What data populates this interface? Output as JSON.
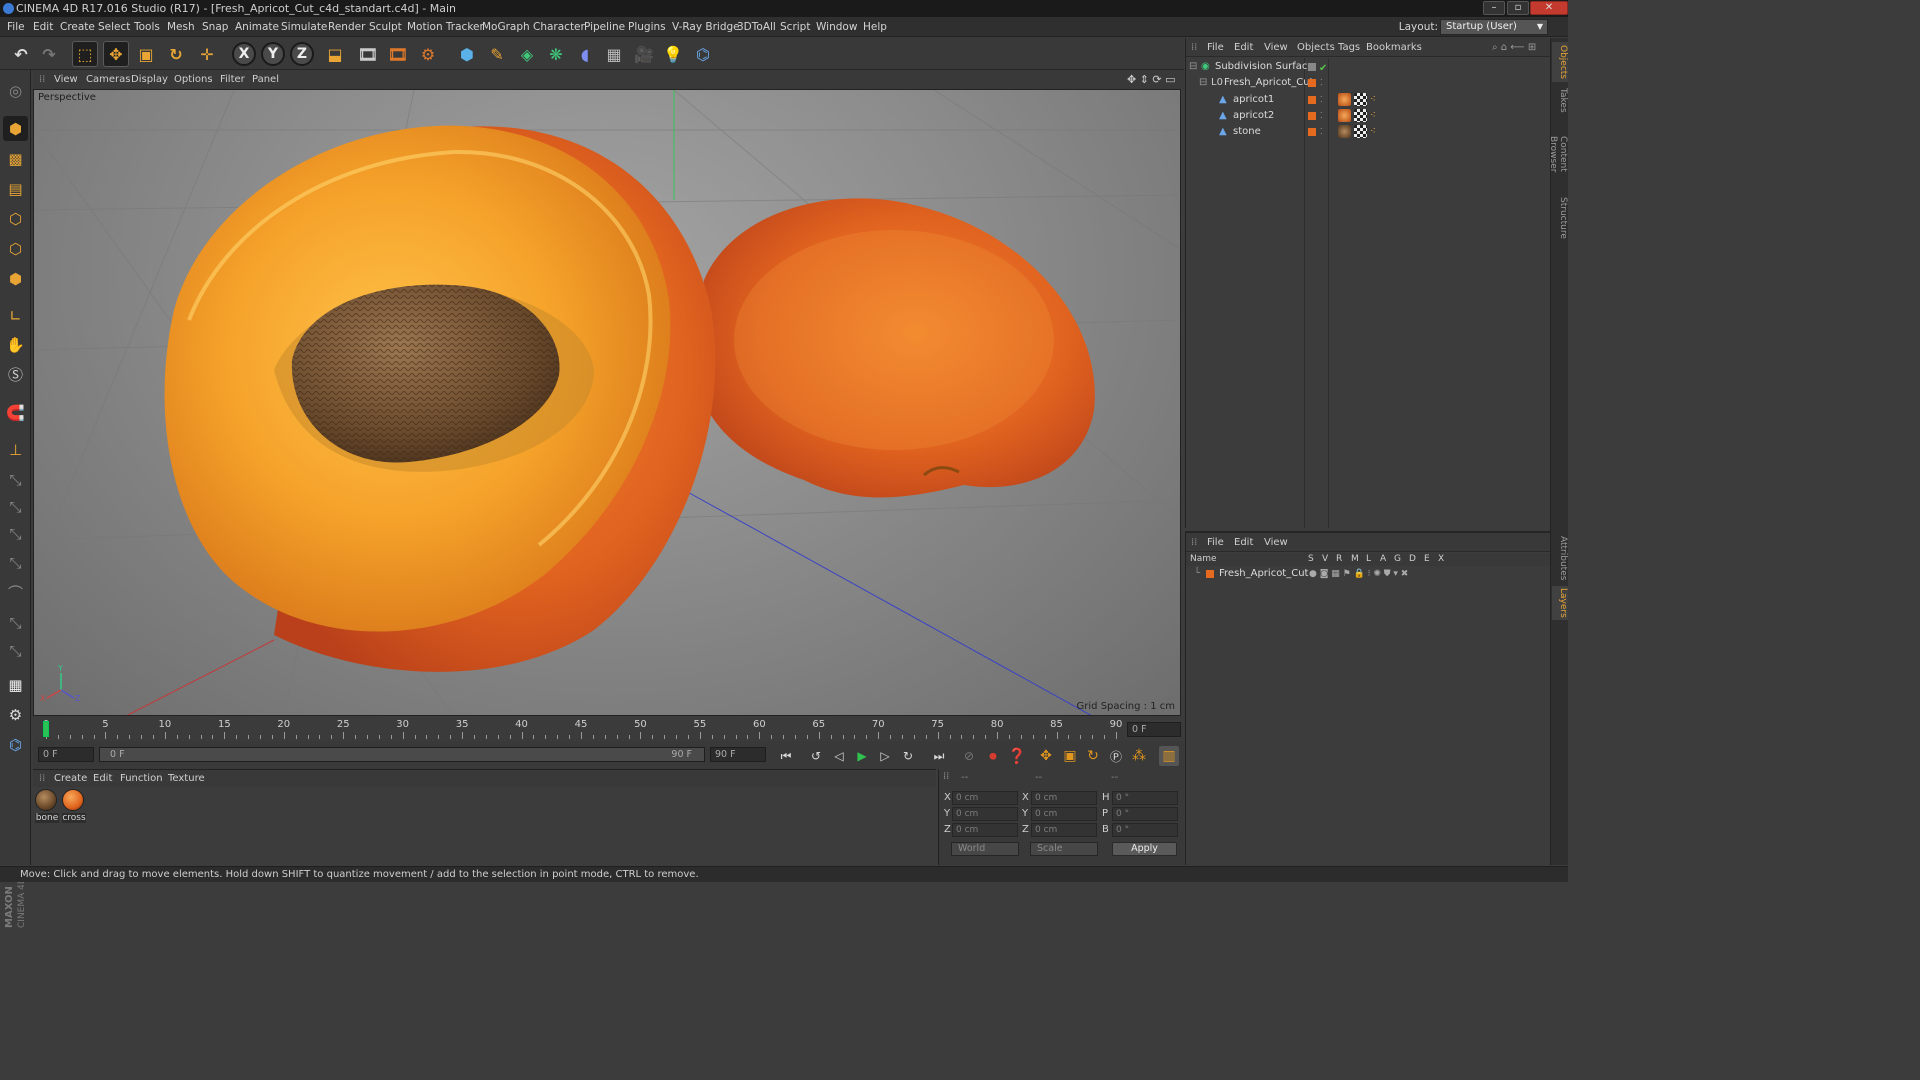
{
  "titlebar": {
    "title": "CINEMA 4D R17.016 Studio (R17) - [Fresh_Apricot_Cut_c4d_standart.c4d] - Main",
    "min": "–",
    "max": "▫",
    "close": "✕"
  },
  "menubar": {
    "items": [
      "File",
      "Edit",
      "Create",
      "Select",
      "Tools",
      "Mesh",
      "Snap",
      "Animate",
      "Simulate",
      "Render",
      "Sculpt",
      "Motion Tracker",
      "MoGraph",
      "Character",
      "Pipeline",
      "Plugins",
      "V-Ray Bridge",
      "3DToAll",
      "Script",
      "Window",
      "Help"
    ],
    "layout_label": "Layout:",
    "layout_value": "Startup (User)"
  },
  "toolbar": {
    "axis_x": "X",
    "axis_y": "Y",
    "axis_z": "Z",
    "icons": [
      "undo-icon",
      "redo-icon",
      "select-icon",
      "move-icon",
      "scale-icon",
      "rotate-icon",
      "axis-icon",
      "x-lock-icon",
      "y-lock-icon",
      "z-lock-icon",
      "coordinate-system-icon",
      "render-view-icon",
      "render-picture-viewer-icon",
      "render-settings-icon",
      "cube-icon",
      "pen-icon",
      "subdivision-icon",
      "array-icon",
      "deformer-icon",
      "floor-icon",
      "camera-icon",
      "light-icon",
      "python-icon"
    ]
  },
  "viewport": {
    "menu": [
      "View",
      "Cameras",
      "Display",
      "Options",
      "Filter",
      "Panel"
    ],
    "label": "Perspective",
    "grid_spacing": "Grid Spacing : 1 cm",
    "axis_x": "X",
    "axis_y": "Y",
    "axis_z": "Z"
  },
  "timeline": {
    "labels": [
      "0",
      "5",
      "10",
      "15",
      "20",
      "25",
      "30",
      "35",
      "40",
      "45",
      "50",
      "55",
      "60",
      "65",
      "70",
      "75",
      "80",
      "85",
      "90"
    ],
    "current_frame_field": "0 F",
    "start_field": "0 F",
    "range_start": "0 F",
    "range_end": "90 F",
    "end_field": "90 F"
  },
  "materials": {
    "menu": [
      "Create",
      "Edit",
      "Function",
      "Texture"
    ],
    "items": [
      {
        "label": "bone",
        "color": "#6b4a2b"
      },
      {
        "label": "cross",
        "color": "#e0651e"
      }
    ]
  },
  "coordinates": {
    "header": [
      "--",
      "--",
      "--"
    ],
    "rows": [
      {
        "a": "X",
        "av": "0 cm",
        "b": "X",
        "bv": "0 cm",
        "c": "H",
        "cv": "0 °"
      },
      {
        "a": "Y",
        "av": "0 cm",
        "b": "Y",
        "bv": "0 cm",
        "c": "P",
        "cv": "0 °"
      },
      {
        "a": "Z",
        "av": "0 cm",
        "b": "Z",
        "bv": "0 cm",
        "c": "B",
        "cv": "0 °"
      }
    ],
    "mode": "World",
    "scale": "Scale",
    "apply": "Apply"
  },
  "status": "Move: Click and drag to move elements. Hold down SHIFT to quantize movement / add to the selection in point mode, CTRL to remove.",
  "object_manager": {
    "menu": [
      "File",
      "Edit",
      "View",
      "Objects",
      "Tags",
      "Bookmarks"
    ],
    "objects": [
      {
        "name": "Subdivision Surface",
        "indent": 0,
        "type": "subdivision"
      },
      {
        "name": "Fresh_Apricot_Cut",
        "indent": 1,
        "type": "null"
      },
      {
        "name": "apricot1",
        "indent": 2,
        "type": "mesh"
      },
      {
        "name": "apricot2",
        "indent": 2,
        "type": "mesh"
      },
      {
        "name": "stone",
        "indent": 2,
        "type": "mesh"
      }
    ],
    "check_mark": "✔"
  },
  "layer_manager": {
    "menu": [
      "File",
      "Edit",
      "View"
    ],
    "columns": [
      "Name",
      "S",
      "V",
      "R",
      "M",
      "L",
      "A",
      "G",
      "D",
      "E",
      "X"
    ],
    "layers": [
      {
        "name": "Fresh_Apricot_Cut",
        "color": "#e56a1f"
      }
    ]
  },
  "side_tabs": [
    "Objects",
    "Takes",
    "Content Browser",
    "Structure",
    "Attributes",
    "Layers"
  ],
  "colors": {
    "accent_orange": "#e8a535",
    "layer_orange": "#e56a1f",
    "play_green": "#2fc24f"
  },
  "brand": {
    "line1": "MAXON",
    "line2": "CINEMA 4D"
  }
}
